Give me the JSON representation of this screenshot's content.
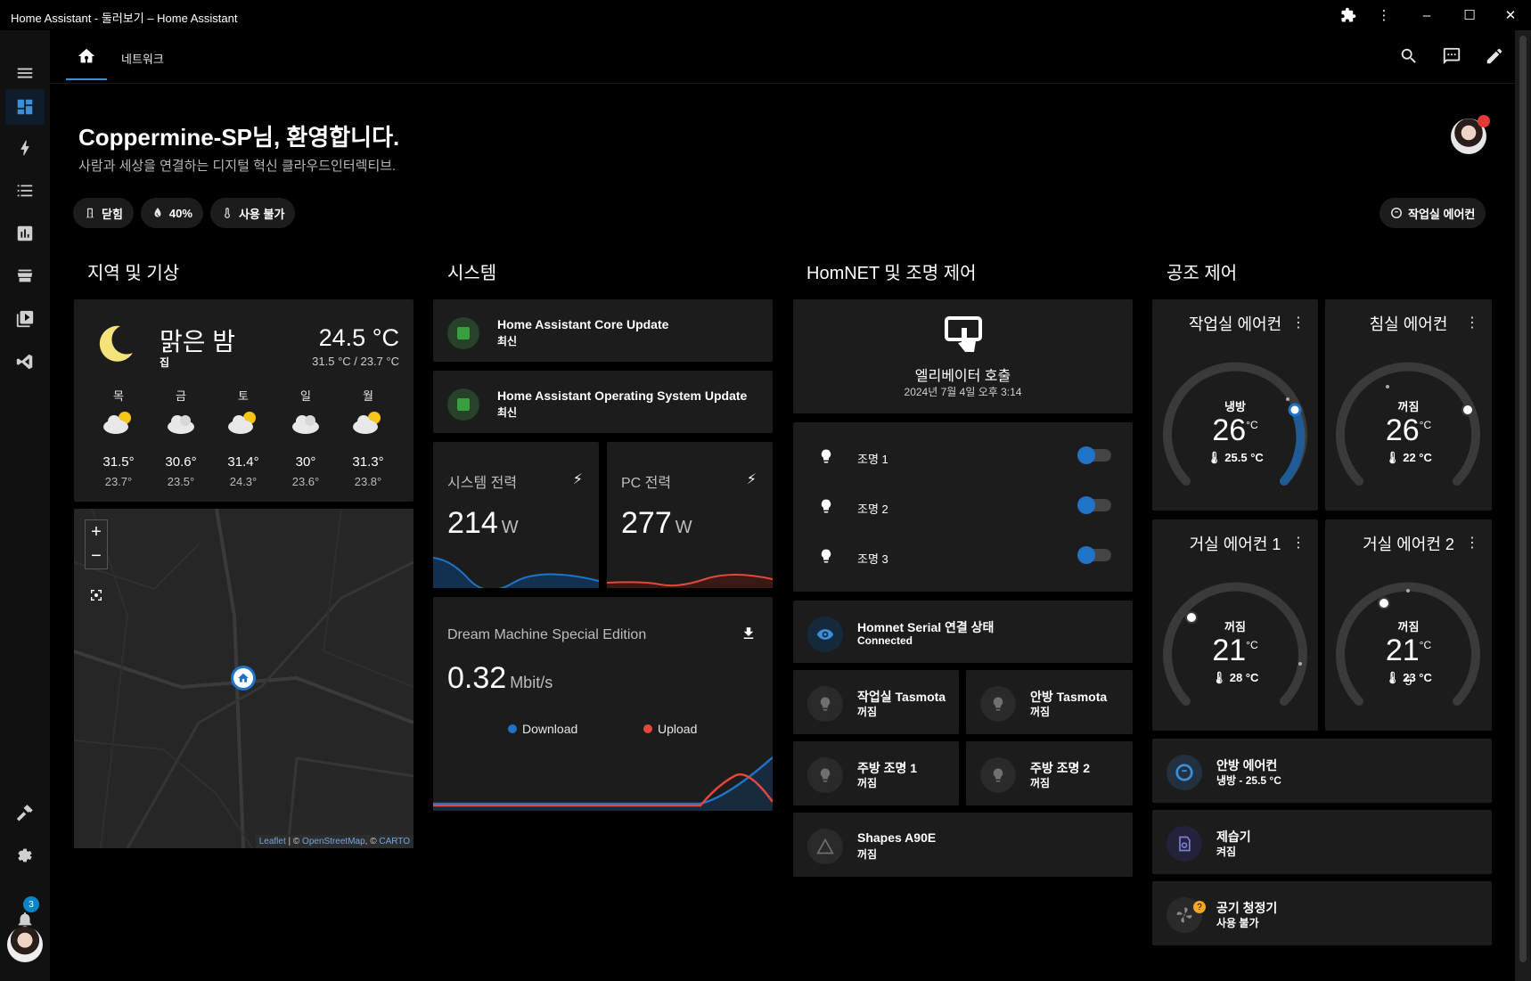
{
  "window": {
    "title": "Home Assistant - 둘러보기 – Home Assistant"
  },
  "nav": {
    "tab_network": "네트워크",
    "notifications_count": "3"
  },
  "header": {
    "welcome": "Coppermine-SP님, 환영합니다.",
    "subtitle": "사람과 세상을 연결하는 디지털 혁신 클라우드인터렉티브."
  },
  "chips": [
    {
      "label": "닫힘",
      "icon": "door-icon"
    },
    {
      "label": "40%",
      "icon": "humidity-icon"
    },
    {
      "label": "사용 불가",
      "icon": "thermometer-icon"
    }
  ],
  "chip_right": {
    "label": "작업실 에어컨",
    "icon": "air-conditioner-icon"
  },
  "sections": {
    "weather": "지역 및 기상",
    "system": "시스템",
    "homnet": "HomNET 및 조명 제어",
    "climate": "공조 제어"
  },
  "weather": {
    "condition": "맑은 밤",
    "location": "집",
    "temperature": "24.5 °C",
    "range": "31.5 °C / 23.7 °C",
    "forecast": [
      {
        "day": "목",
        "hi": "31.5°",
        "lo": "23.7°",
        "icon": "partly-cloudy-icon"
      },
      {
        "day": "금",
        "hi": "30.6°",
        "lo": "23.5°",
        "icon": "cloudy-icon"
      },
      {
        "day": "토",
        "hi": "31.4°",
        "lo": "24.3°",
        "icon": "partly-cloudy-icon"
      },
      {
        "day": "일",
        "hi": "30°",
        "lo": "23.6°",
        "icon": "cloudy-icon"
      },
      {
        "day": "월",
        "hi": "31.3°",
        "lo": "23.8°",
        "icon": "partly-cloudy-icon"
      }
    ]
  },
  "map": {
    "zoom_in": "+",
    "zoom_out": "−",
    "attr_leaflet": "Leaflet",
    "attr_osm": "OpenStreetMap",
    "attr_carto": "CARTO",
    "attr_sep1": " | © ",
    "attr_sep2": ", © "
  },
  "updates": [
    {
      "title": "Home Assistant Core Update",
      "state": "최신"
    },
    {
      "title": "Home Assistant Operating System Update",
      "state": "최신"
    }
  ],
  "power": [
    {
      "title": "시스템 전력",
      "value": "214",
      "unit": "W",
      "color": "#1f73c9"
    },
    {
      "title": "PC 전력",
      "value": "277",
      "unit": "W",
      "color": "#e5483b"
    }
  ],
  "network": {
    "title": "Dream Machine Special Edition",
    "value": "0.32",
    "unit": "Mbit/s",
    "legend_download": "Download",
    "legend_upload": "Upload",
    "download_color": "#1f73c9",
    "upload_color": "#e5483b"
  },
  "elevator": {
    "title": "엘리베이터 호출",
    "time": "2024년 7월 4일 오후 3:14"
  },
  "lights": [
    {
      "label": "조명 1",
      "on": true
    },
    {
      "label": "조명 2",
      "on": true
    },
    {
      "label": "조명 3",
      "on": true
    }
  ],
  "homnet_serial": {
    "name": "Homnet Serial 연결 상태",
    "state": "Connected"
  },
  "tasmota": [
    {
      "name": "작업실 Tasmota",
      "state": "꺼짐"
    },
    {
      "name": "안방 Tasmota",
      "state": "꺼짐"
    },
    {
      "name": "주방 조명 1",
      "state": "꺼짐"
    },
    {
      "name": "주방 조명 2",
      "state": "꺼짐"
    }
  ],
  "shapes": {
    "name": "Shapes A90E",
    "state": "꺼짐"
  },
  "climate": [
    {
      "name": "작업실 에어컨",
      "mode": "냉방",
      "target": "26",
      "unit": "°C",
      "current": "25.5 °C",
      "active": true
    },
    {
      "name": "침실 에어컨",
      "mode": "꺼짐",
      "target": "26",
      "unit": "°C",
      "current": "22 °C",
      "active": false
    },
    {
      "name": "거실 에어컨 1",
      "mode": "꺼짐",
      "target": "21",
      "unit": "°C",
      "current": "28 °C",
      "active": false
    },
    {
      "name": "거실 에어컨 2",
      "mode": "꺼짐",
      "target": "21",
      "unit": "°C",
      "decimal": "5",
      "current": "23 °C",
      "active": false
    }
  ],
  "climate_list": [
    {
      "name": "안방 에어컨",
      "state": "냉방 - 25.5 °C"
    },
    {
      "name": "제습기",
      "state": "켜짐"
    },
    {
      "name": "공기 청정기",
      "state": "사용 불가"
    }
  ]
}
